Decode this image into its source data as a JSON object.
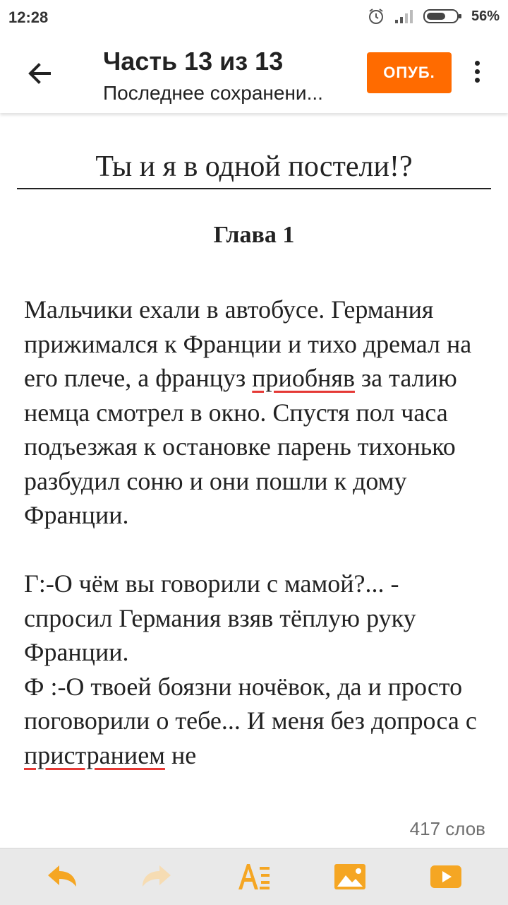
{
  "status_bar": {
    "time": "12:28",
    "battery_percent": "56%",
    "icons": [
      "alarm-icon",
      "signal-icon",
      "battery-icon"
    ]
  },
  "app_bar": {
    "title": "Часть 13 из 13",
    "subtitle": "Последнее сохранени...",
    "publish_label": "ОПУБ.",
    "icons": [
      "back-arrow-icon",
      "more-vert-icon"
    ]
  },
  "document": {
    "story_title": "Ты и я в одной постели!?",
    "chapter_title": "Глава 1",
    "paragraphs": [
      {
        "before": "Мальчики ехали в автобусе. Германия прижимался к Франции и тихо дремал на его плече, а француз ",
        "misspelled": "приобняв",
        "after": " за талию немца смотрел в окно. Спустя пол часа подъезжая к остановке парень тихонько разбудил соню и они пошли к дому Франции."
      },
      {
        "line1": "Г:-О чём вы говорили с мамой?... - спросил Германия взяв тёплую руку Франции.",
        "line2_before": "Ф :-О твоей боязни ночёвок, да и просто поговорили о тебе... И меня без допроса с ",
        "line2_misspelled": "пристранием",
        "line2_after": " не"
      }
    ],
    "word_count": "417 слов"
  },
  "toolbar": {
    "items": [
      "undo-icon",
      "redo-icon",
      "text-format-icon",
      "insert-image-icon",
      "insert-video-icon"
    ]
  },
  "colors": {
    "accent": "#ff6b00",
    "spellcheck": "#e53935",
    "toolbar_bg": "#e9e9e9"
  }
}
